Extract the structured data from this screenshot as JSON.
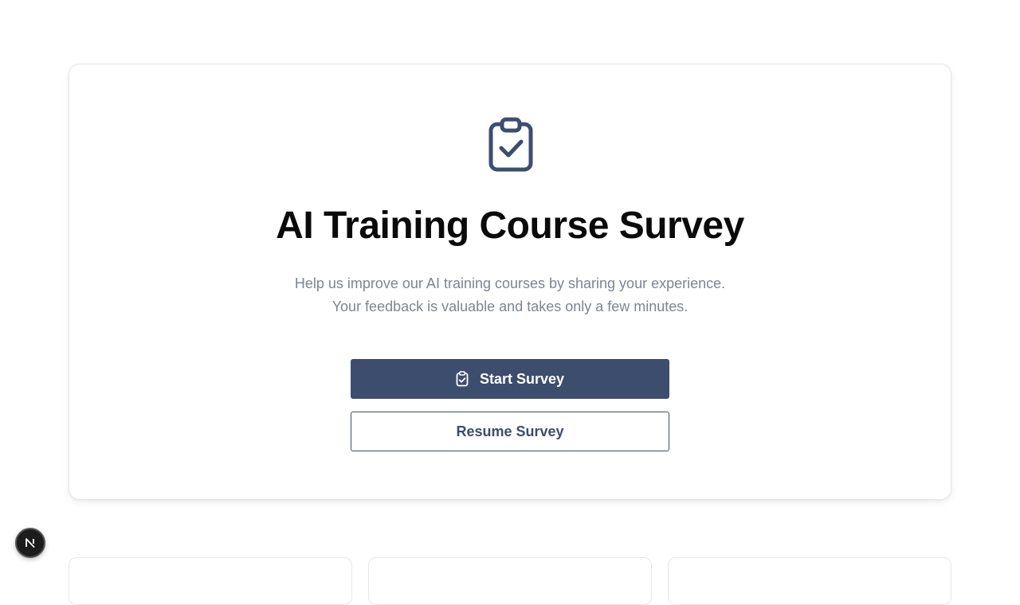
{
  "hero": {
    "icon": "clipboard-check-icon",
    "title": "AI Training Course Survey",
    "description_line1": "Help us improve our AI training courses by sharing your experience.",
    "description_line2": "Your feedback is valuable and takes only a few minutes."
  },
  "actions": {
    "start_label": "Start Survey",
    "start_icon": "clipboard-check-icon",
    "resume_label": "Resume Survey"
  },
  "devtools": {
    "badge_icon": "nextjs-n-icon"
  },
  "colors": {
    "accent": "#3d4d6e",
    "title": "#0a0a0a",
    "muted_text": "#7d8592",
    "border": "#e5e7eb"
  }
}
